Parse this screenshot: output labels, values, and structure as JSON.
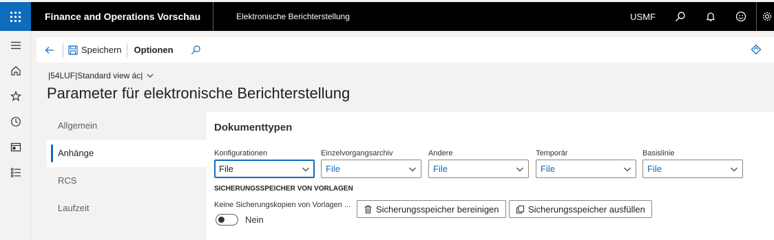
{
  "topbar": {
    "app_title": "Finance and Operations Vorschau",
    "module_title": "Elektronische Berichterstellung",
    "company": "USMF"
  },
  "action_pane": {
    "save_label": "Speichern",
    "options_label": "Optionen"
  },
  "header": {
    "view_selector": "|54LUF|Standard view ác|",
    "page_title": "Parameter für elektronische Berichterstellung"
  },
  "tabs": [
    {
      "label": "Allgemein",
      "active": false
    },
    {
      "label": "Anhänge",
      "active": true
    },
    {
      "label": "RCS",
      "active": false
    },
    {
      "label": "Laufzeit",
      "active": false
    }
  ],
  "section": {
    "title": "Dokumenttypen",
    "fields": [
      {
        "label": "Konfigurationen",
        "value": "File"
      },
      {
        "label": "Einzelvorgangsarchiv",
        "value": "File"
      },
      {
        "label": "Andere",
        "value": "File"
      },
      {
        "label": "Temporär",
        "value": "File"
      },
      {
        "label": "Basislinie",
        "value": "File"
      }
    ],
    "storage_heading": "SICHERUNGSSPEICHER VON VORLAGEN",
    "no_backup_label": "Keine Sicherungskopien von Vorlagen ...",
    "toggle_value": "Nein",
    "clear_button": "Sicherungsspeicher bereinigen",
    "fill_button": "Sicherungsspeicher ausfüllen"
  },
  "colors": {
    "accent": "#0f6cbd",
    "topbar_bg": "#000000",
    "page_bg": "#f3f2f1"
  }
}
